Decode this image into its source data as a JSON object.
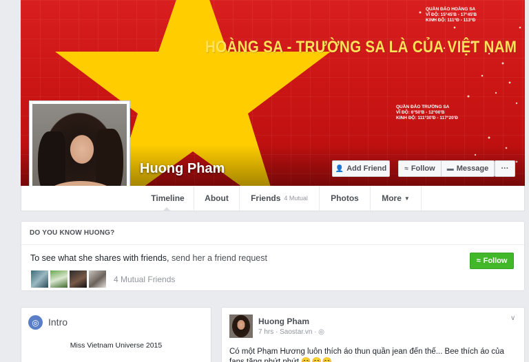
{
  "cover": {
    "banner": "HOÀNG SA - TRƯỜNG SA LÀ CỦA VIỆT NAM",
    "geo1_title": "QUẦN ĐẢO HOÀNG SA",
    "geo1_lat": "VĨ ĐỘ: 15°45'B - 17°45'B",
    "geo1_lon": "KINH ĐỘ: 111°Đ - 113°Đ",
    "geo2_title": "QUẦN ĐẢO TRƯỜNG SA",
    "geo2_lat": "VĨ ĐỘ: 6°50'B - 12°00'B",
    "geo2_lon": "KINH ĐỘ: 111°30'Đ - 117°20'Đ",
    "flag_red": "#da251d",
    "star_yellow": "#ffcd00"
  },
  "profile": {
    "name": "Huong Pham"
  },
  "actions": {
    "add_friend": "Add Friend",
    "follow": "Follow",
    "message": "Message",
    "more": "···"
  },
  "tabs": {
    "timeline": "Timeline",
    "about": "About",
    "friends": "Friends",
    "friends_sub": "4 Mutual",
    "photos": "Photos",
    "more": "More"
  },
  "know_card": {
    "heading": "DO YOU KNOW HUONG?",
    "text": "To see what she shares with friends, ",
    "link": "send her a friend request",
    "follow_label": "Follow",
    "mutual": "4 Mutual Friends",
    "follow_color": "#42b72a"
  },
  "intro": {
    "title": "Intro",
    "bio": "Miss Vietnam Universe 2015"
  },
  "post": {
    "author": "Huong Pham",
    "time": "7 hrs",
    "source": "Saostar.vn",
    "text": "Có một Phạm Hương luôn thích áo thun quần jean đến thế... ",
    "text2": "Bee thích áo của fans tặng phứt phứt ",
    "emoji": "😊😊😊"
  },
  "icons": [
    "add-friend-icon",
    "rss-follow-icon",
    "message-icon",
    "more-dots-icon",
    "caret-down-icon",
    "globe-icon",
    "chevron-down-icon"
  ]
}
